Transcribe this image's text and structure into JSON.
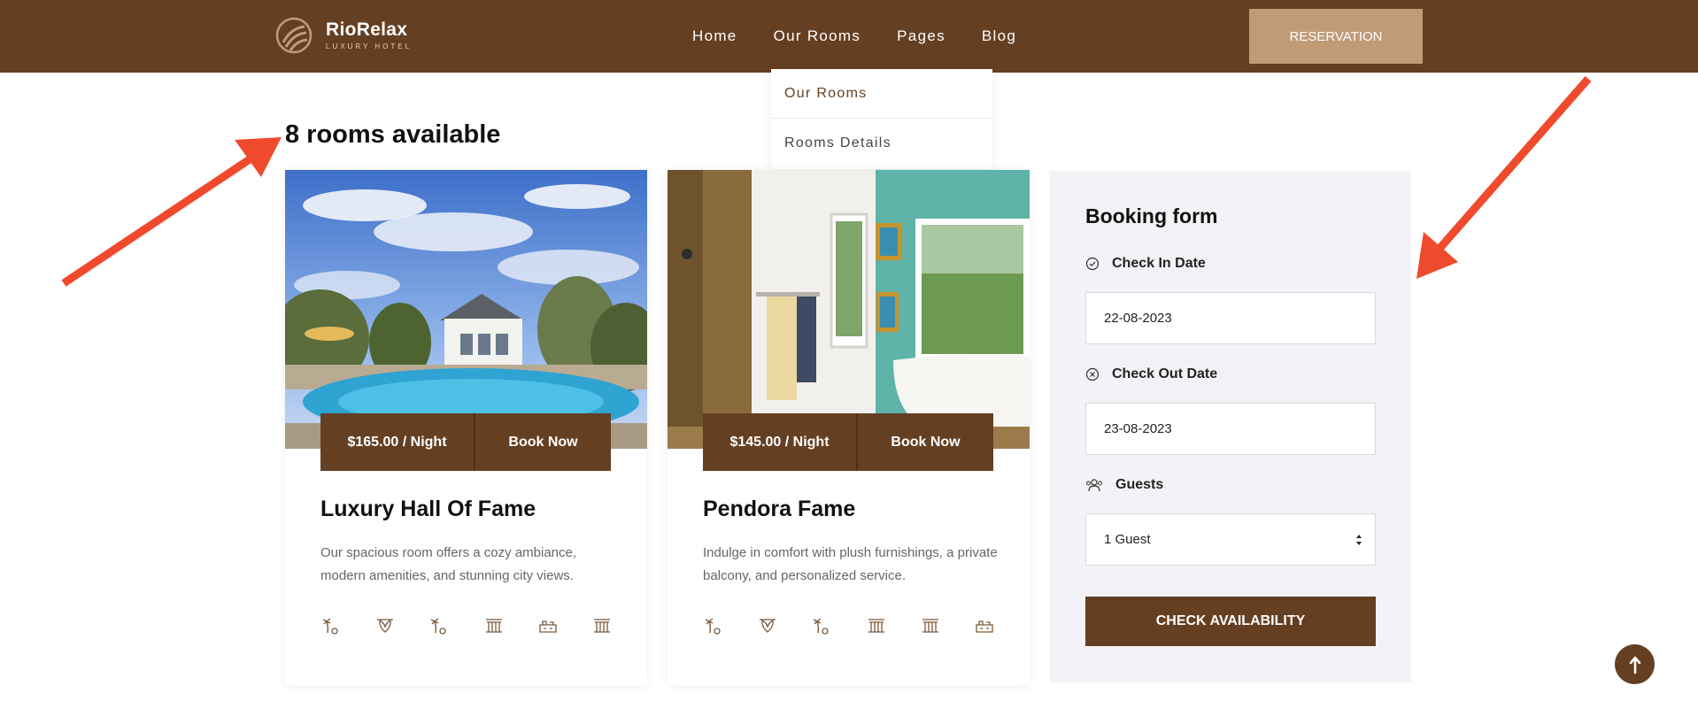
{
  "header": {
    "brand_name": "RioRelax",
    "brand_tagline": "LUXURY HOTEL",
    "nav": [
      "Home",
      "Our Rooms",
      "Pages",
      "Blog"
    ],
    "reserve_label": "RESERVATION",
    "brand_color": "#653f22",
    "accent_color": "#c19a78"
  },
  "dropdown": {
    "items": [
      "Our Rooms",
      "Rooms Details"
    ]
  },
  "main": {
    "rooms_available": "8 rooms available"
  },
  "rooms": [
    {
      "price": "$165.00 / Night",
      "book_label": "Book Now",
      "title": "Luxury Hall Of Fame",
      "description": "Our spacious room offers a cozy ambiance, modern amenities, and stunning city views.",
      "amenities": [
        "palm-icon",
        "spa-icon",
        "palm-icon",
        "pavilion-icon",
        "desk-icon",
        "pavilion-icon"
      ]
    },
    {
      "price": "$145.00 / Night",
      "book_label": "Book Now",
      "title": "Pendora Fame",
      "description": "Indulge in comfort with plush furnishings, a private balcony, and personalized service.",
      "amenities": [
        "palm-icon",
        "spa-icon",
        "palm-icon",
        "pavilion-icon",
        "pavilion-icon",
        "desk-icon"
      ]
    }
  ],
  "booking": {
    "title": "Booking form",
    "checkin_label": "Check In Date",
    "checkin_value": "22-08-2023",
    "checkout_label": "Check Out Date",
    "checkout_value": "23-08-2023",
    "guests_label": "Guests",
    "guests_value": "1 Guest",
    "submit_label": "CHECK AVAILABILITY"
  },
  "annotation_color": "#f04a2c"
}
